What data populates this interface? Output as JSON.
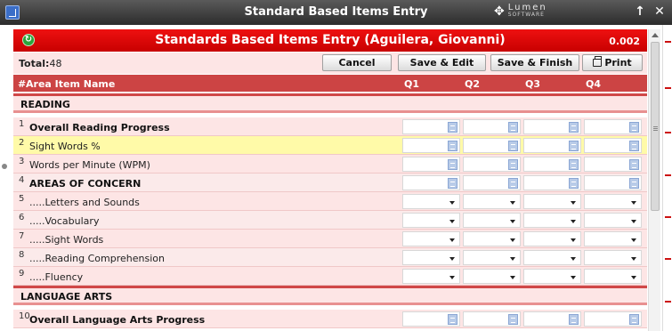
{
  "window": {
    "title": "Standard Based Items Entry",
    "logo_line1": "Lumen",
    "logo_line2": "SOFTWARE",
    "up_glyph": "🠝",
    "close_glyph": "✕"
  },
  "header": {
    "title": "Standards Based Items Entry (Aguilera, Giovanni)",
    "version": "0.002"
  },
  "toolbar": {
    "total_label": "Total:",
    "total_value": "48",
    "cancel": "Cancel",
    "save_edit": "Save & Edit",
    "save_finish": "Save & Finish",
    "print": "Print"
  },
  "columns": {
    "num": "#",
    "name": "Area Item Name",
    "q1": "Q1",
    "q2": "Q2",
    "q3": "Q3",
    "q4": "Q4"
  },
  "sections": {
    "reading": "READING",
    "language_arts": "LANGUAGE ARTS"
  },
  "rows": [
    {
      "num": "1",
      "name": "Overall Reading Progress"
    },
    {
      "num": "2",
      "name": "Sight Words %"
    },
    {
      "num": "3",
      "name": "Words per Minute (WPM)"
    },
    {
      "num": "4",
      "name": "AREAS OF CONCERN"
    },
    {
      "num": "5",
      "name": ".....Letters and Sounds"
    },
    {
      "num": "6",
      "name": ".....Vocabulary"
    },
    {
      "num": "7",
      "name": ".....Sight Words"
    },
    {
      "num": "8",
      "name": ".....Reading Comprehension"
    },
    {
      "num": "9",
      "name": ".....Fluency"
    },
    {
      "num": "10",
      "name": "Overall Language Arts Progress"
    }
  ],
  "colors": {
    "header_red": "#e00000",
    "column_header": "#cc4444",
    "row_pink": "#fde5e5",
    "row_highlight": "#fffaa8"
  },
  "icons": {
    "app": "window-app-icon",
    "header": "refresh-icon",
    "print": "printer-icon",
    "picker": "picker-icon",
    "dropdown": "chevron-down-icon"
  }
}
